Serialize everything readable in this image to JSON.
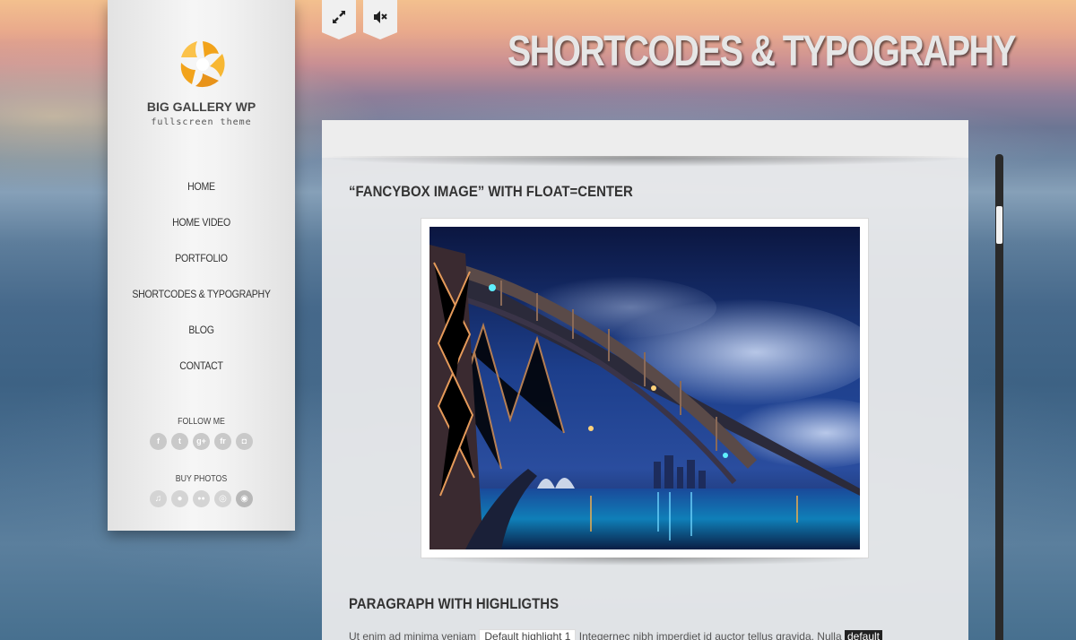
{
  "sidebar": {
    "brand": "BIG GALLERY WP",
    "tagline": "fullscreen theme",
    "nav": [
      "HOME",
      "HOME VIDEO",
      "PORTFOLIO",
      "SHORTCODES & TYPOGRAPHY",
      "BLOG",
      "CONTACT"
    ],
    "follow_label": "FOLLOW ME",
    "social_icons": [
      {
        "name": "facebook-icon",
        "glyph": "f"
      },
      {
        "name": "twitter-icon",
        "glyph": "t"
      },
      {
        "name": "google-plus-icon",
        "glyph": "g+"
      },
      {
        "name": "flickr-icon",
        "glyph": "fr"
      },
      {
        "name": "instagram-icon",
        "glyph": "◘"
      }
    ],
    "buy_label": "BUY PHOTOS",
    "buy_icons": [
      {
        "name": "music-icon",
        "glyph": "♫"
      },
      {
        "name": "pixel-icon",
        "glyph": "●"
      },
      {
        "name": "dots-icon",
        "glyph": "●●"
      },
      {
        "name": "target-icon",
        "glyph": "◎"
      },
      {
        "name": "globe-icon",
        "glyph": "◉"
      }
    ]
  },
  "controls": {
    "fullscreen_icon": "expand-icon",
    "mute_icon": "sound-off-icon"
  },
  "page_title": "SHORTCODES & TYPOGRAPHY",
  "content": {
    "heading1": "“FANCYBOX IMAGE” WITH FLOAT=CENTER",
    "heading2": "PARAGRAPH WITH HIGHLIGTHS",
    "para_start": "Ut enim ad minima veniam ",
    "highlight1": "Default highlight 1",
    "para_mid": " Integernec nibh imperdiet id auctor tellus gravida. Nulla ",
    "highlight2": "default"
  },
  "colors": {
    "accent_orange": "#f2a31b",
    "sidebar_bg": "#f1f1f1",
    "scrollbar": "#2a2a2a"
  }
}
